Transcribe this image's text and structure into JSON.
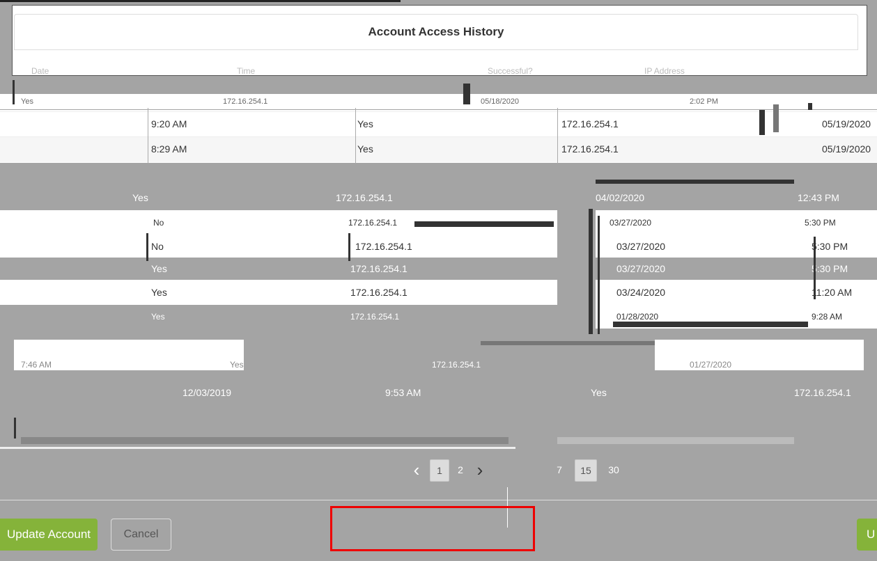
{
  "panel": {
    "title": "Account Access History"
  },
  "columns": [
    "Date",
    "Time",
    "Successful?",
    "IP Address"
  ],
  "rows_clean": [
    {
      "time": "9:20 AM",
      "successful": "Yes",
      "ip": "172.16.254.1",
      "date": "05/19/2020"
    },
    {
      "time": "8:29 AM",
      "successful": "Yes",
      "ip": "172.16.254.1",
      "date": "05/19/2020"
    }
  ],
  "rows_glitched": [
    {
      "a": "Yes",
      "b": "172.16.254.1",
      "c": "05/18/2020",
      "d": "2:02 PM"
    },
    {
      "a": "Yes",
      "b": "172.16.254.1",
      "c": "04/02/2020",
      "d": "12:43 PM"
    },
    {
      "a": "No",
      "b": "172.16.254.1",
      "c": "03/27/2020",
      "d": "5:30 PM"
    },
    {
      "a": "No",
      "b": "172.16.254.1",
      "c": "03/27/2020",
      "d": "5:30 PM"
    },
    {
      "a": "Yes",
      "b": "172.16.254.1",
      "c": "03/27/2020",
      "d": "5:30 PM"
    },
    {
      "a": "Yes",
      "b": "172.16.254.1",
      "c": "03/24/2020",
      "d": "11:20 AM"
    },
    {
      "a": "Yes",
      "b": "172.16.254.1",
      "c": "01/28/2020",
      "d": "9:28 AM"
    },
    {
      "a": "7:46 AM",
      "b": "Yes",
      "c": "172.16.254.1",
      "d": "01/27/2020"
    },
    {
      "a": "12/03/2019",
      "b": "9:53 AM",
      "c": "Yes",
      "d": "172.16.254.1"
    }
  ],
  "pagination": {
    "pages": [
      "1",
      "2"
    ],
    "active_page": "1",
    "page_sizes": [
      "7",
      "15",
      "30"
    ],
    "active_page_size": "15"
  },
  "footer": {
    "update_label": "Update Account",
    "cancel_label": "Cancel",
    "update_right_label": "U"
  },
  "colors": {
    "accent_green": "#85b33a",
    "highlight_red": "#e00000",
    "backdrop": "#a4a4a4"
  }
}
